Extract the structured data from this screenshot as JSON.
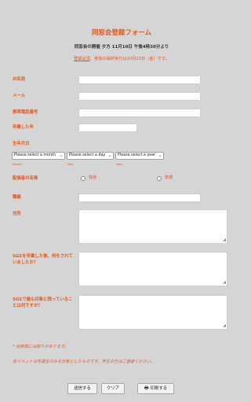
{
  "form": {
    "title": "同窓会登録フォーム",
    "subtitle": "同窓会の開催 夕方 11月10日 午後4時30分より",
    "note_underlined": "登録必須",
    "note_rest": "、参加の最終受付は10月20日（金）です。"
  },
  "fields": {
    "name": "お名前",
    "email": "メール",
    "phone": "携帯電話番号",
    "grad_year": "卒業した年",
    "birthdate": "生年月日",
    "spouse": "配偶者の有無",
    "occupation": "職業",
    "address": "住所",
    "after_sgs": "SGSを卒業した後、何をされていましたか？",
    "memorable": "SGSで最も印象に残っていることは何ですか？"
  },
  "birthdate": {
    "month_select": "Please select a month",
    "day_select": "Please select a day",
    "year_select": "Please select a year",
    "month_hint": "Month",
    "day_hint": "Day",
    "year_hint": "Year"
  },
  "spouse_options": {
    "single": "独身",
    "married": "既婚"
  },
  "footnotes": {
    "limit": "* 座席数には限りがあります。",
    "graduates_only": "本イベントは卒業生のみを対象としたものです。学生の方はご遠慮ください。"
  },
  "buttons": {
    "submit": "送信する",
    "clear": "クリア",
    "print": "印刷する"
  },
  "colors": {
    "accent": "#e8571c",
    "background": "#d5d5d5"
  }
}
